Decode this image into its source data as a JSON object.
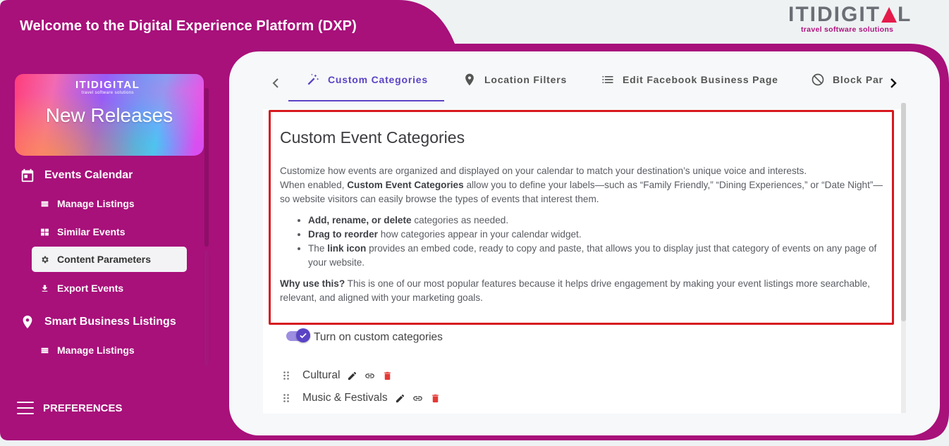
{
  "header": {
    "title": "Welcome to the Digital Experience Platform (DXP)"
  },
  "logo": {
    "left": "ITI",
    "right": "DIGIT",
    "end": "L",
    "tagline": "travel software solutions"
  },
  "promo": {
    "logo": "ITIDIGITAL",
    "logo_sub": "travel software solutions",
    "title": "New Releases"
  },
  "sidebar": {
    "sections": [
      {
        "label": "Events Calendar",
        "icon": "calendar-icon",
        "items": [
          {
            "label": "Manage Listings",
            "icon": "list-icon"
          },
          {
            "label": "Similar Events",
            "icon": "grid-icon"
          },
          {
            "label": "Content Parameters",
            "icon": "gear-icon",
            "active": true
          },
          {
            "label": "Export Events",
            "icon": "download-icon"
          }
        ]
      },
      {
        "label": "Smart Business Listings",
        "icon": "location-pin-icon",
        "items": [
          {
            "label": "Manage Listings",
            "icon": "list-icon"
          }
        ]
      }
    ],
    "preferences": "PREFERENCES"
  },
  "tabs": [
    {
      "label": "Custom Categories",
      "icon": "magic-wand-icon",
      "active": true
    },
    {
      "label": "Location Filters",
      "icon": "location-pin-icon"
    },
    {
      "label": "Edit Facebook Business Page",
      "icon": "list-icon"
    },
    {
      "label": "Block Par",
      "icon": "block-icon"
    }
  ],
  "content": {
    "title": "Custom Event Categories",
    "intro_1": "Customize how events are organized and displayed on your calendar to match your destination’s unique voice and interests.",
    "intro_2_pre": "When enabled, ",
    "intro_2_bold": "Custom Event Categories",
    "intro_2_post": " allow you to define your labels—such as “Family Friendly,” “Dining Experiences,” or “Date Night”—so website visitors can easily browse the types of events that interest them.",
    "bullets": [
      {
        "bold": "Add, rename, or delete",
        "text": " categories as needed."
      },
      {
        "bold": "Drag to reorder",
        "text": " how categories appear in your calendar widget."
      },
      {
        "pre": "The ",
        "bold": "link icon",
        "text": " provides an embed code, ready to copy and paste, that allows you to display just that category of events on any page of your website."
      }
    ],
    "why_bold": "Why use this?",
    "why_text": " This is one of our most popular features because it helps drive engagement by making your event listings more searchable, relevant, and aligned with your marketing goals.",
    "toggle_label": "Turn on custom categories",
    "toggle_on": true,
    "categories": [
      "Cultural",
      "Music & Festivals"
    ]
  },
  "colors": {
    "frame": "#a8107a",
    "accent": "#5b43c6",
    "highlight": "#d7191f",
    "delete": "#e53935"
  }
}
